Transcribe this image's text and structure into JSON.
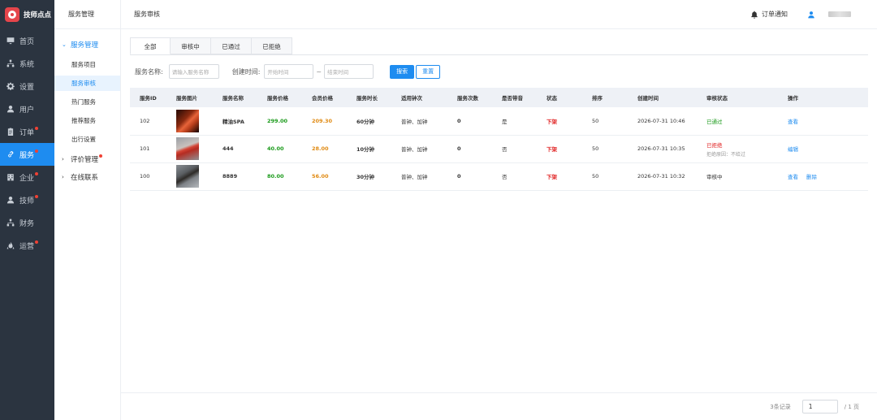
{
  "brand": {
    "name": "技师点点"
  },
  "nav": [
    {
      "label": "首页",
      "icon": "monitor-icon",
      "dot": false,
      "active": false
    },
    {
      "label": "系统",
      "icon": "org-chart-icon",
      "dot": false,
      "active": false
    },
    {
      "label": "设置",
      "icon": "gear-icon",
      "dot": false,
      "active": false
    },
    {
      "label": "用户",
      "icon": "user-icon",
      "dot": false,
      "active": false
    },
    {
      "label": "订单",
      "icon": "clipboard-icon",
      "dot": true,
      "active": false
    },
    {
      "label": "服务",
      "icon": "link-icon",
      "dot": true,
      "active": true
    },
    {
      "label": "企业",
      "icon": "building-icon",
      "dot": true,
      "active": false
    },
    {
      "label": "技师",
      "icon": "user-icon",
      "dot": true,
      "active": false
    },
    {
      "label": "财务",
      "icon": "org-chart-icon",
      "dot": false,
      "active": false
    },
    {
      "label": "运营",
      "icon": "fire-icon",
      "dot": true,
      "active": false
    }
  ],
  "subnav": {
    "title": "服务管理",
    "group_open": "服务管理",
    "items": [
      "服务项目",
      "服务审核",
      "热门服务",
      "推荐服务",
      "出行设置"
    ],
    "active_index": 1,
    "group_review": "评价管理",
    "group_contact": "在线联系"
  },
  "header": {
    "breadcrumb": "服务审核",
    "notice": "订单通知"
  },
  "tabs": [
    "全部",
    "审核中",
    "已通过",
    "已拒绝"
  ],
  "filters": {
    "name_label": "服务名称:",
    "name_placeholder": "请输入服务名称",
    "time_label": "创建时间:",
    "start_placeholder": "开始时间",
    "separator": "~",
    "end_placeholder": "结束时间",
    "search_btn": "搜索",
    "reset_btn": "重置"
  },
  "table": {
    "columns": [
      "服务ID",
      "服务图片",
      "服务名称",
      "服务价格",
      "会员价格",
      "服务时长",
      "适用钟次",
      "服务次数",
      "是否带音",
      "状态",
      "排序",
      "创建时间",
      "审核状态",
      "操作"
    ],
    "rows": [
      {
        "id": "102",
        "name": "精油SPA",
        "price": "299.00",
        "member_price": "209.30",
        "duration": "60分钟",
        "clock": "普钟、加钟",
        "count": "0",
        "voice": "是",
        "status": "下架",
        "sort": "50",
        "created": "2026-07-31 10:46",
        "review": "已通过",
        "review_type": "ok",
        "reason": "",
        "actions": [
          "查看"
        ]
      },
      {
        "id": "101",
        "name": "444",
        "price": "40.00",
        "member_price": "28.00",
        "duration": "10分钟",
        "clock": "普钟、加钟",
        "count": "0",
        "voice": "否",
        "status": "下架",
        "sort": "50",
        "created": "2026-07-31 10:35",
        "review": "已拒绝",
        "review_type": "rej",
        "reason": "拒绝原因：不给过",
        "actions": [
          "编辑"
        ]
      },
      {
        "id": "100",
        "name": "8889",
        "price": "80.00",
        "member_price": "56.00",
        "duration": "30分钟",
        "clock": "普钟、加钟",
        "count": "0",
        "voice": "否",
        "status": "下架",
        "sort": "50",
        "created": "2026-07-31 10:32",
        "review": "审核中",
        "review_type": "pending",
        "reason": "",
        "actions": [
          "查看",
          "删除"
        ]
      }
    ]
  },
  "pager": {
    "total": "3条记录",
    "page": "1",
    "pages": "/ 1 页"
  },
  "colors": {
    "accent": "#1e8cf0",
    "sidebar": "#2b3440",
    "green": "#1a9a1a",
    "orange": "#e08a12",
    "red": "#e02020"
  }
}
